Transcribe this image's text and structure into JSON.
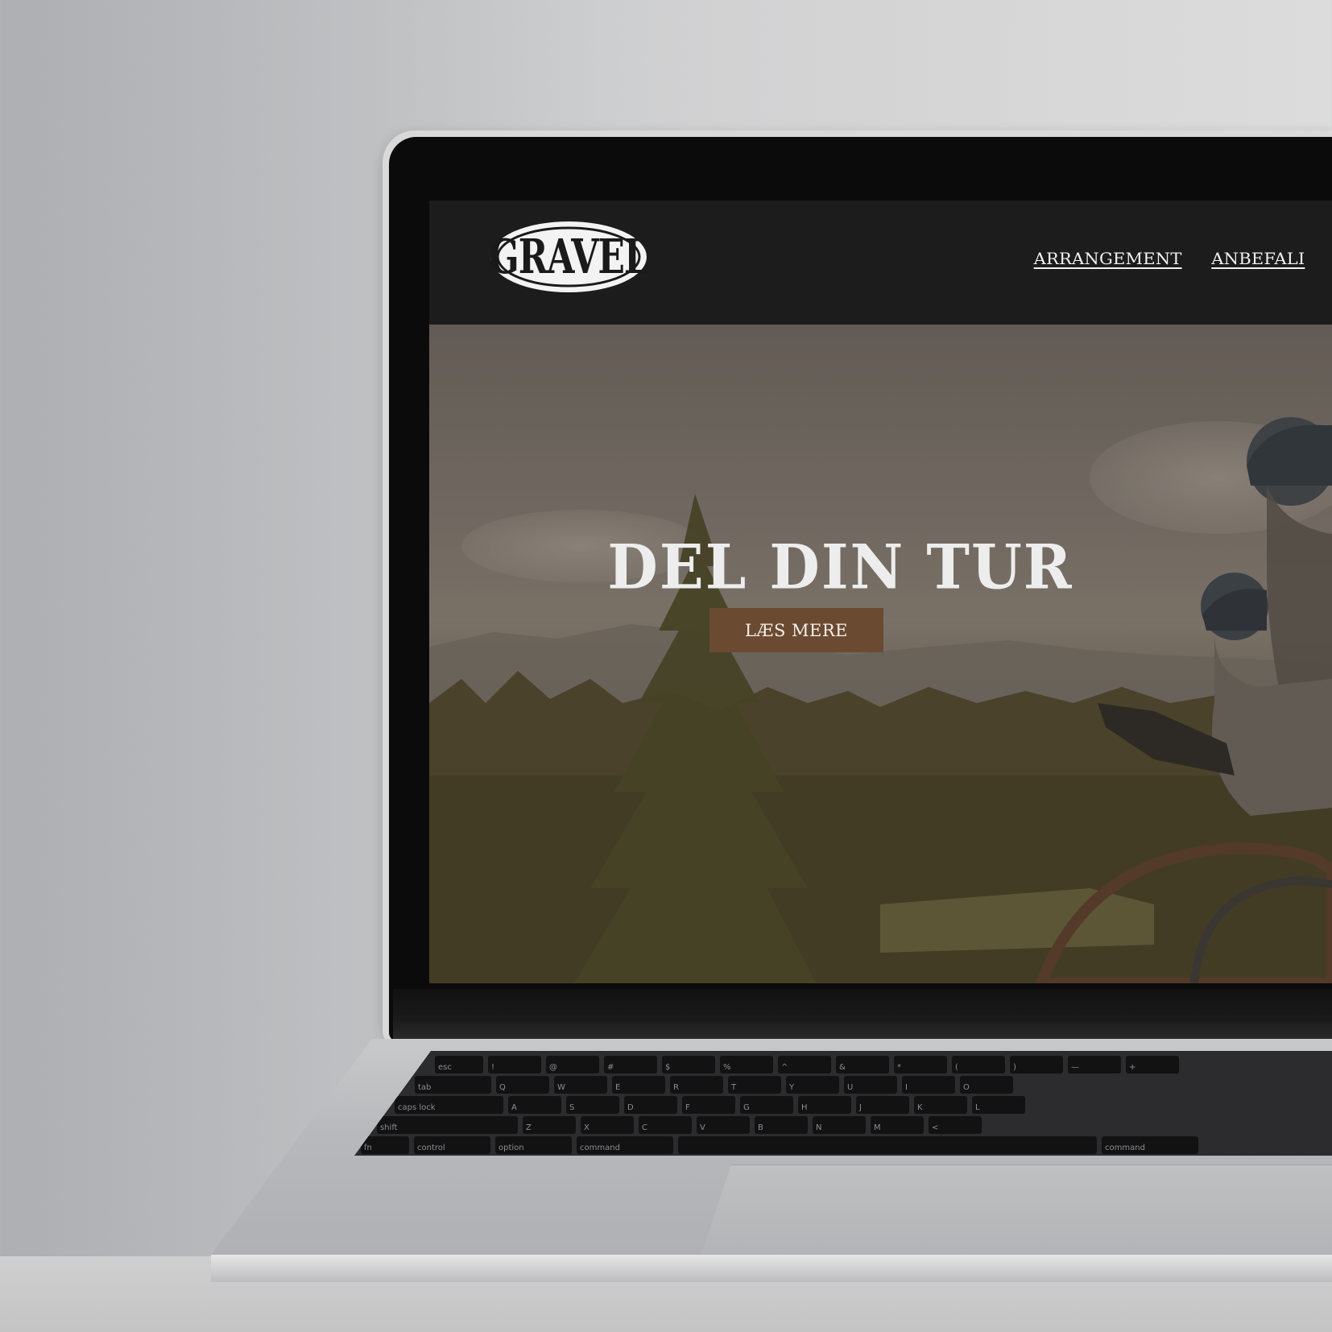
{
  "site": {
    "logo_text": "GRAVEL",
    "nav": [
      {
        "label": "ARRANGEMENT"
      },
      {
        "label": "ANBEFALI"
      }
    ]
  },
  "hero": {
    "title": "DEL DIN TUR",
    "cta_label": "LÆS MERE"
  },
  "keyboard": {
    "row1": [
      "esc",
      "!",
      "@",
      "#",
      "$",
      "%",
      "^",
      "&",
      "*",
      "(",
      ")",
      "—",
      "+"
    ],
    "row2": [
      "tab",
      "Q",
      "W",
      "E",
      "R",
      "T",
      "Y",
      "U",
      "I",
      "O"
    ],
    "row3": [
      "caps lock",
      "A",
      "S",
      "D",
      "F",
      "G",
      "H",
      "J",
      "K",
      "L"
    ],
    "row4": [
      "shift",
      "Z",
      "X",
      "C",
      "V",
      "B",
      "N",
      "M",
      "<"
    ],
    "row5": [
      "fn",
      "control",
      "option",
      "command",
      "",
      "command"
    ]
  },
  "colors": {
    "header_bg": "#1c1c1c",
    "cta_bg": "#6b4a32",
    "text_light": "#ededed"
  }
}
